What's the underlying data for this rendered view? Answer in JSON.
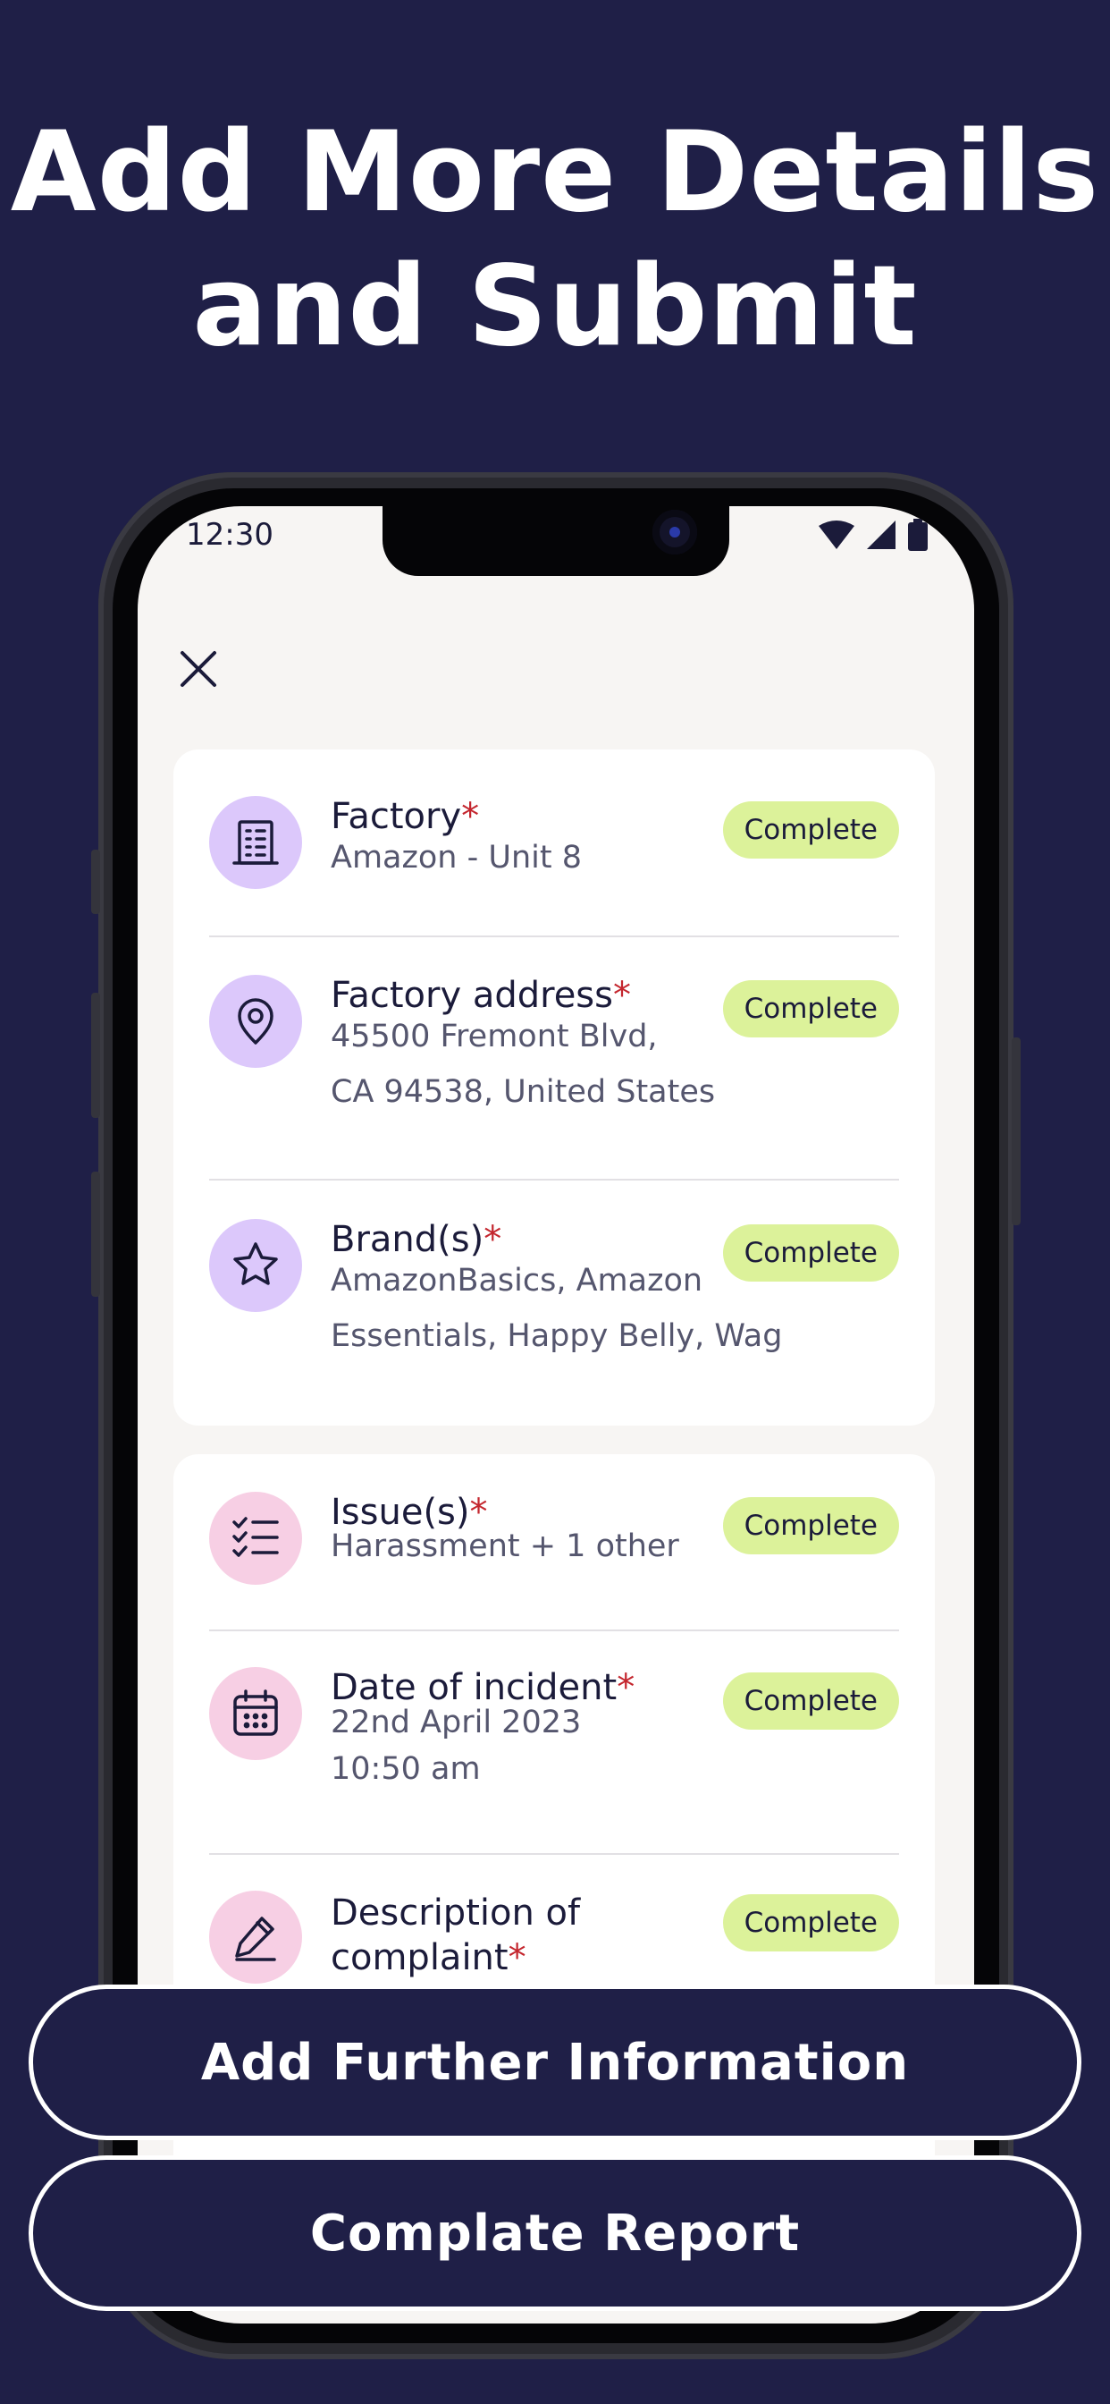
{
  "headline": {
    "line1": "Add More Details",
    "line2": "and Submit"
  },
  "status_bar": {
    "time": "12:30",
    "icons": [
      "wifi-icon",
      "signal-icon",
      "battery-icon"
    ]
  },
  "close_icon": "close-icon",
  "card1": [
    {
      "title": "Factory",
      "required": "*",
      "subtitle_lines": [
        "Amazon - Unit 8"
      ],
      "badge": "Complete",
      "icon": "building-icon"
    },
    {
      "title": "Factory address",
      "required": "*",
      "subtitle_lines": [
        "45500 Fremont Blvd,",
        "CA 94538, United States"
      ],
      "badge": "Complete",
      "icon": "location-pin-icon"
    },
    {
      "title": "Brand(s)",
      "required": "*",
      "subtitle_lines": [
        "AmazonBasics, Amazon",
        "Essentials, Happy Belly, Wag"
      ],
      "badge": "Complete",
      "icon": "star-icon"
    }
  ],
  "card2": [
    {
      "title": "Issue(s)",
      "required": "*",
      "subtitle_lines": [
        "Harassment + 1 other"
      ],
      "badge": "Complete",
      "icon": "checklist-icon"
    },
    {
      "title": "Date of incident",
      "required": "*",
      "subtitle_lines": [
        "22nd April 2023",
        "10:50 am"
      ],
      "badge": "Complete",
      "icon": "calendar-icon"
    },
    {
      "title_lines": [
        "Description of",
        "complaint"
      ],
      "required": "*",
      "badge": "Complete",
      "icon": "pencil-icon"
    }
  ],
  "buttons": {
    "add_info": "Add Further Information",
    "complete": "Complate Report"
  },
  "colors": {
    "background": "#1f1f47",
    "badge": "#dcf29a",
    "required": "#c4262e",
    "icon_purple": "#dcc8fb",
    "icon_pink": "#f7cfe4"
  }
}
